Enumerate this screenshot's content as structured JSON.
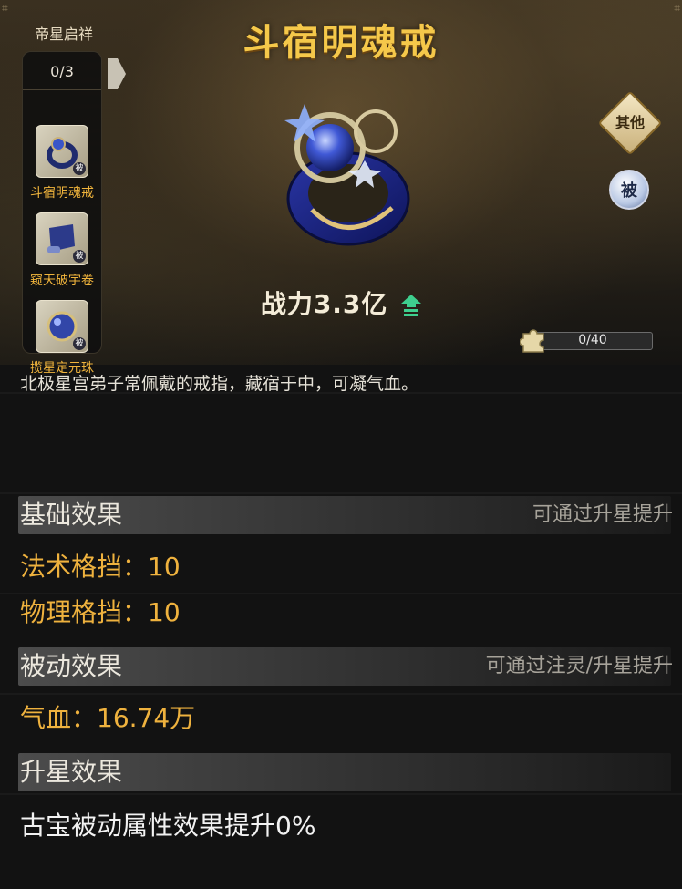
{
  "item": {
    "name": "斗宿明魂戒",
    "power_label": "战力3.3亿",
    "description": "北极星宫弟子常佩戴的戒指，藏宿于中，可凝气血。"
  },
  "set_panel": {
    "title": "帝星启祥",
    "count": "0/3",
    "items": [
      {
        "label": "斗宿明魂戒",
        "tag": "被"
      },
      {
        "label": "窥天破宇卷",
        "tag": "被"
      },
      {
        "label": "揽星定元珠",
        "tag": "被"
      }
    ]
  },
  "badges": {
    "other": "其他",
    "passive": "被"
  },
  "fragments": {
    "progress": "0/40",
    "fraction": 0.0
  },
  "sections": {
    "basic": {
      "title": "基础效果",
      "note": "可通过升星提升",
      "stats": [
        "法术格挡：10",
        "物理格挡：10"
      ]
    },
    "passive": {
      "title": "被动效果",
      "note": "可通过注灵/升星提升",
      "stats": [
        "气血：16.74万"
      ]
    },
    "star": {
      "title": "升星效果",
      "text": "古宝被动属性效果提升0%"
    }
  },
  "colors": {
    "title_gold": "#f5c84a",
    "stat_orange": "#efb23e",
    "power_up_green": "#3ecf8e"
  },
  "icons": [
    "ring-icon",
    "scroll-icon",
    "orb-icon",
    "puzzle-icon",
    "power-up-arrow-icon",
    "expand-arrow-icon"
  ]
}
